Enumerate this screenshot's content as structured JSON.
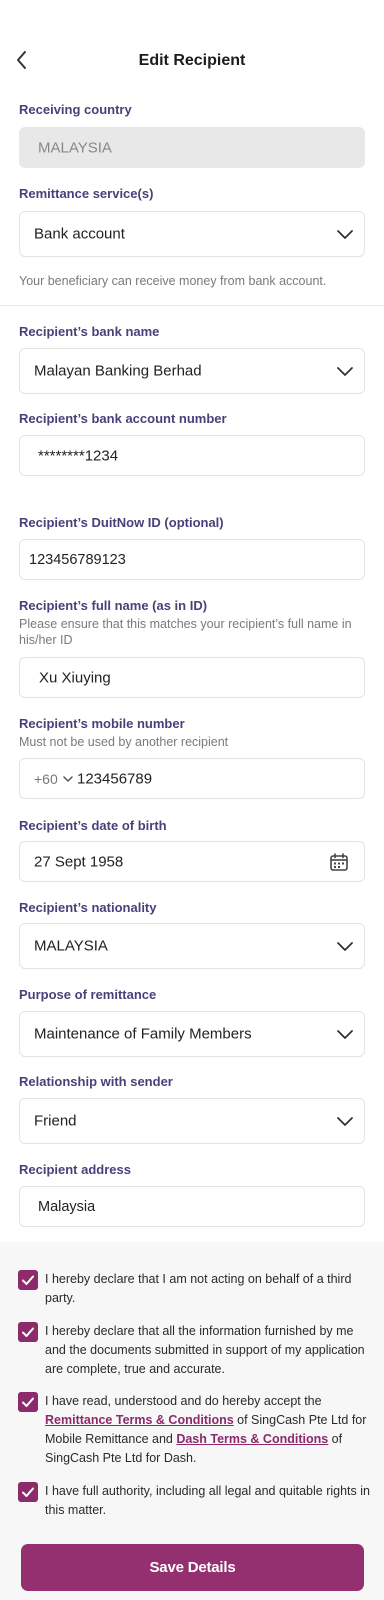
{
  "header": {
    "title": "Edit Recipient"
  },
  "receiving_country": {
    "label": "Receiving country",
    "value": "MALAYSIA"
  },
  "remittance_service": {
    "label": "Remittance service(s)",
    "value": "Bank account",
    "hint": "Your beneficiary can receive money from bank account."
  },
  "bank_name": {
    "label": "Recipient’s bank name",
    "value": "Malayan Banking Berhad"
  },
  "bank_account": {
    "label": "Recipient’s bank account number",
    "value": "********1234"
  },
  "duitnow": {
    "label": "Recipient’s DuitNow ID (optional)",
    "value": "123456789123"
  },
  "full_name": {
    "label": "Recipient’s full name (as in ID)",
    "hint": "Please ensure that this matches your recipient’s full name in his/her ID",
    "value": "Xu Xiuying"
  },
  "mobile": {
    "label": "Recipient’s mobile number",
    "hint": "Must not be used by another recipient",
    "code": "+60",
    "value": "123456789"
  },
  "dob": {
    "label": "Recipient’s date of birth",
    "value": "27 Sept 1958"
  },
  "nationality": {
    "label": "Recipient’s nationality",
    "value": "MALAYSIA"
  },
  "purpose": {
    "label": "Purpose of remittance",
    "value": "Maintenance of Family Members"
  },
  "relationship": {
    "label": "Relationship with sender",
    "value": "Friend"
  },
  "address": {
    "label": "Recipient address",
    "value": "Malaysia"
  },
  "declarations": {
    "d1": "I hereby declare that I am not acting on behalf of a third party.",
    "d2": "I hereby declare that all the information furnished by me and the documents submitted in support of my application are complete, true and accurate.",
    "d3_a": "I have read, understood and do hereby accept the ",
    "d3_link1": "Remittance Terms & Conditions",
    "d3_b": " of SingCash Pte Ltd for Mobile Remittance and ",
    "d3_link2": "Dash Terms & Conditions",
    "d3_c": " of SingCash Pte Ltd for Dash.",
    "d4": "I have full authority, including all legal and quitable rights in this matter."
  },
  "save_label": "Save Details",
  "colors": {
    "accent": "#94306f",
    "label": "#4b3f7a"
  },
  "icons": [
    "back-arrow-icon",
    "chevron-down-icon",
    "calendar-icon",
    "checkbox-checked-icon"
  ]
}
